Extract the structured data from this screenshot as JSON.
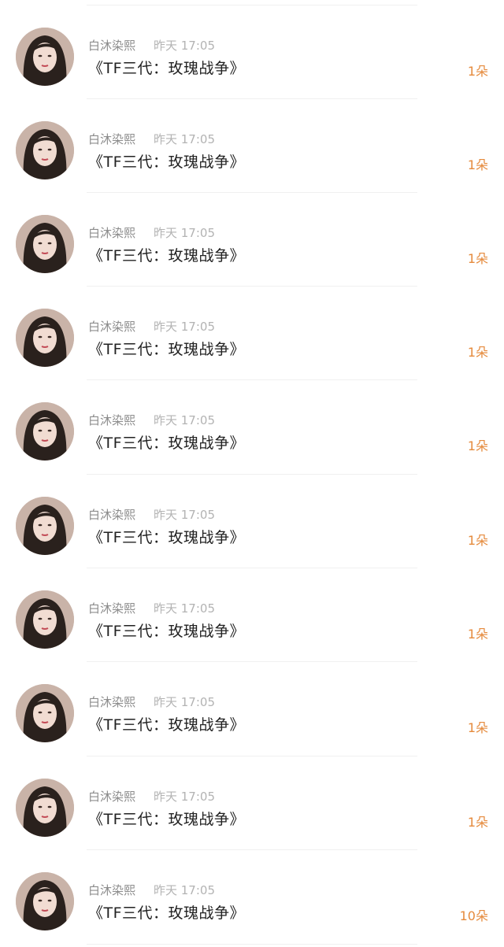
{
  "items": [
    {
      "name": "白沐染熙",
      "time": "昨天 17:05",
      "title": "《TF三代：玫瑰战争》",
      "count": "1朵",
      "avatar_icon": "user-avatar"
    },
    {
      "name": "白沐染熙",
      "time": "昨天 17:05",
      "title": "《TF三代：玫瑰战争》",
      "count": "1朵",
      "avatar_icon": "user-avatar"
    },
    {
      "name": "白沐染熙",
      "time": "昨天 17:05",
      "title": "《TF三代：玫瑰战争》",
      "count": "1朵",
      "avatar_icon": "user-avatar"
    },
    {
      "name": "白沐染熙",
      "time": "昨天 17:05",
      "title": "《TF三代：玫瑰战争》",
      "count": "1朵",
      "avatar_icon": "user-avatar"
    },
    {
      "name": "白沐染熙",
      "time": "昨天 17:05",
      "title": "《TF三代：玫瑰战争》",
      "count": "1朵",
      "avatar_icon": "user-avatar"
    },
    {
      "name": "白沐染熙",
      "time": "昨天 17:05",
      "title": "《TF三代：玫瑰战争》",
      "count": "1朵",
      "avatar_icon": "user-avatar"
    },
    {
      "name": "白沐染熙",
      "time": "昨天 17:05",
      "title": "《TF三代：玫瑰战争》",
      "count": "1朵",
      "avatar_icon": "user-avatar"
    },
    {
      "name": "白沐染熙",
      "time": "昨天 17:05",
      "title": "《TF三代：玫瑰战争》",
      "count": "1朵",
      "avatar_icon": "user-avatar"
    },
    {
      "name": "白沐染熙",
      "time": "昨天 17:05",
      "title": "《TF三代：玫瑰战争》",
      "count": "1朵",
      "avatar_icon": "user-avatar"
    },
    {
      "name": "白沐染熙",
      "time": "昨天 17:05",
      "title": "《TF三代：玫瑰战争》",
      "count": "10朵",
      "avatar_icon": "user-avatar"
    }
  ],
  "colors": {
    "count": "#e58a3c",
    "name": "#8c8c8c",
    "time": "#b3b3b3",
    "title": "#222222"
  }
}
